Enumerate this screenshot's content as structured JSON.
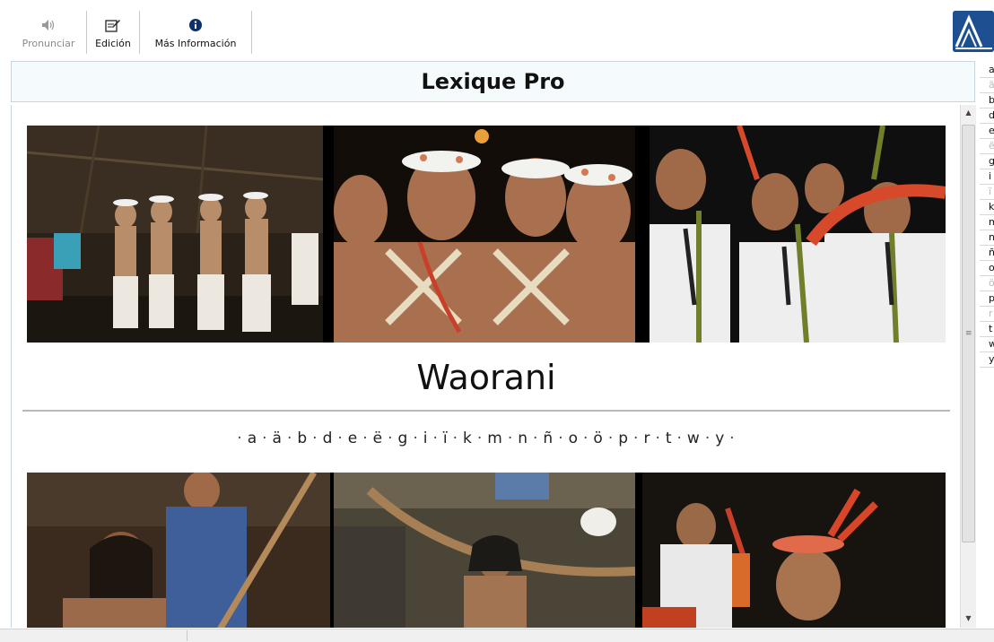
{
  "toolbar": {
    "buttons": [
      {
        "label": "Pronunciar",
        "icon": "speaker-icon",
        "enabled": false
      },
      {
        "label": "Edición",
        "icon": "edit-icon",
        "enabled": true
      },
      {
        "label": "Más Información",
        "icon": "info-icon",
        "enabled": true
      }
    ],
    "logo_text": "SIL"
  },
  "title_bar": {
    "title": "Lexique Pro"
  },
  "content": {
    "language_name": "Waorani",
    "alphabet": [
      "a",
      "ä",
      "b",
      "d",
      "e",
      "ë",
      "g",
      "i",
      "ï",
      "k",
      "m",
      "n",
      "ñ",
      "o",
      "ö",
      "p",
      "r",
      "t",
      "w",
      "y"
    ]
  },
  "index_letters": [
    {
      "label": "a",
      "dim": false
    },
    {
      "label": "ä",
      "dim": true
    },
    {
      "label": "b",
      "dim": false
    },
    {
      "label": "d",
      "dim": false
    },
    {
      "label": "e",
      "dim": false
    },
    {
      "label": "ë",
      "dim": true
    },
    {
      "label": "g",
      "dim": false
    },
    {
      "label": "i",
      "dim": false
    },
    {
      "label": "ï",
      "dim": true
    },
    {
      "label": "k",
      "dim": false
    },
    {
      "label": "m",
      "dim": false
    },
    {
      "label": "n",
      "dim": false
    },
    {
      "label": "ñ",
      "dim": false
    },
    {
      "label": "o",
      "dim": false
    },
    {
      "label": "ö",
      "dim": true
    },
    {
      "label": "p",
      "dim": false
    },
    {
      "label": "r",
      "dim": true
    },
    {
      "label": "t",
      "dim": false
    },
    {
      "label": "w",
      "dim": false
    },
    {
      "label": "y",
      "dim": false
    }
  ],
  "photos": {
    "top": [
      "photo-dancing-women",
      "photo-young-men-feather-crowns",
      "photo-men-playing-flutes"
    ],
    "bottom": [
      "photo-woman-and-boy-with-spear",
      "photo-elder-woman-in-hammock",
      "photo-elder-man-feather-crown"
    ]
  },
  "colors": {
    "logo_blue": "#1d4f91",
    "title_bg": "#f5fbfd"
  }
}
